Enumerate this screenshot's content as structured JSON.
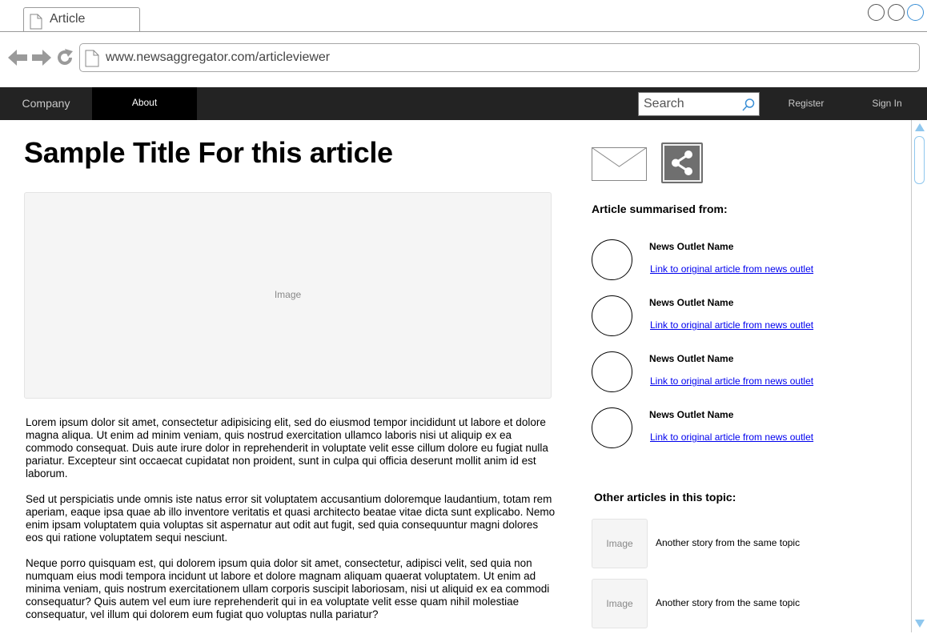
{
  "browser": {
    "tab_title": "Article",
    "url": "www.newsaggregator.com/articleviewer"
  },
  "site_nav": {
    "company": "Company",
    "about": "About",
    "search_placeholder": "Search",
    "register": "Register",
    "sign_in": "Sign In"
  },
  "article": {
    "title": "Sample Title For this article",
    "image_label": "Image",
    "paragraphs": [
      "Lorem ipsum dolor sit amet, consectetur adipisicing elit, sed do eiusmod tempor incididunt ut labore et dolore magna aliqua. Ut enim ad minim veniam, quis nostrud exercitation ullamco laboris nisi ut aliquip ex ea commodo consequat. Duis aute irure dolor in reprehenderit in voluptate velit esse cillum dolore eu fugiat nulla pariatur. Excepteur sint occaecat cupidatat non proident, sunt in culpa qui officia deserunt mollit anim id est laborum.",
      "Sed ut perspiciatis unde omnis iste natus error sit voluptatem accusantium doloremque laudantium, totam rem aperiam, eaque ipsa quae ab illo inventore veritatis et quasi architecto beatae vitae dicta sunt explicabo. Nemo enim ipsam voluptatem quia voluptas sit aspernatur aut odit aut fugit, sed quia consequuntur magni dolores eos qui ratione voluptatem sequi nesciunt.",
      "Neque porro quisquam est, qui dolorem ipsum quia dolor sit amet, consectetur, adipisci velit, sed quia non numquam eius modi tempora incidunt ut labore et dolore magnam aliquam quaerat voluptatem. Ut enim ad minima veniam, quis nostrum exercitationem ullam corporis suscipit laboriosam, nisi ut aliquid ex ea commodi consequatur? Quis autem vel eum iure reprehenderit qui in ea voluptate velit esse quam nihil molestiae consequatur, vel illum qui dolorem eum fugiat quo voluptas nulla pariatur?"
    ]
  },
  "sidebar": {
    "sources_heading": "Article summarised from:",
    "sources": [
      {
        "name": "News Outlet Name",
        "link": "Link to original article from news outlet"
      },
      {
        "name": "News Outlet Name",
        "link": "Link to original article from news outlet"
      },
      {
        "name": "News Outlet Name",
        "link": "Link to original article from news outlet"
      },
      {
        "name": "News Outlet Name",
        "link": "Link to original article from news outlet"
      }
    ],
    "related_heading": "Other articles in this topic:",
    "related": [
      {
        "image_label": "Image",
        "title": "Another story from the same topic"
      },
      {
        "image_label": "Image",
        "title": "Another story from the same topic"
      }
    ]
  }
}
